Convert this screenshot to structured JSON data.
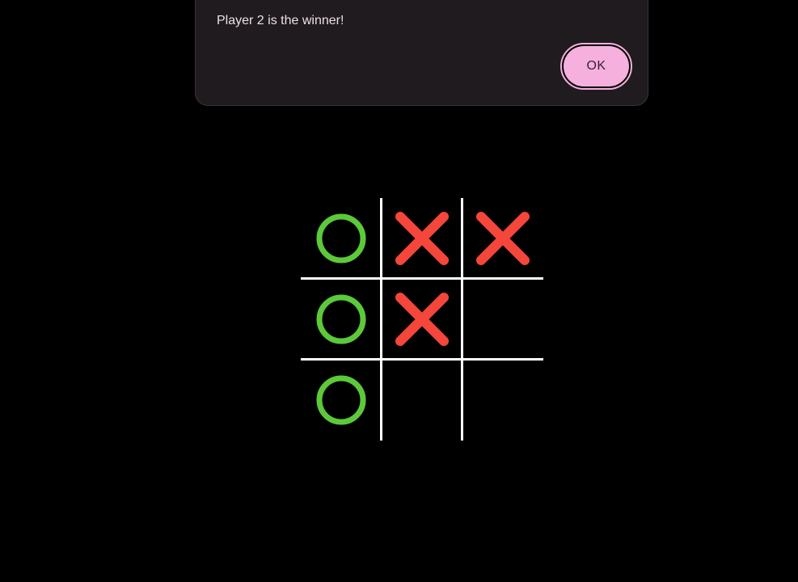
{
  "dialog": {
    "message": "Player 2 is the winner!",
    "ok_label": "OK"
  },
  "board": {
    "cells": [
      [
        "O",
        "X",
        "X"
      ],
      [
        "O",
        "X",
        ""
      ],
      [
        "O",
        "",
        ""
      ]
    ],
    "colors": {
      "o": "#5cc93a",
      "x": "#f4463a",
      "grid": "#ffffff",
      "background": "#000000"
    },
    "icons": {
      "O": "circle-mark-icon",
      "X": "cross-mark-icon"
    }
  }
}
